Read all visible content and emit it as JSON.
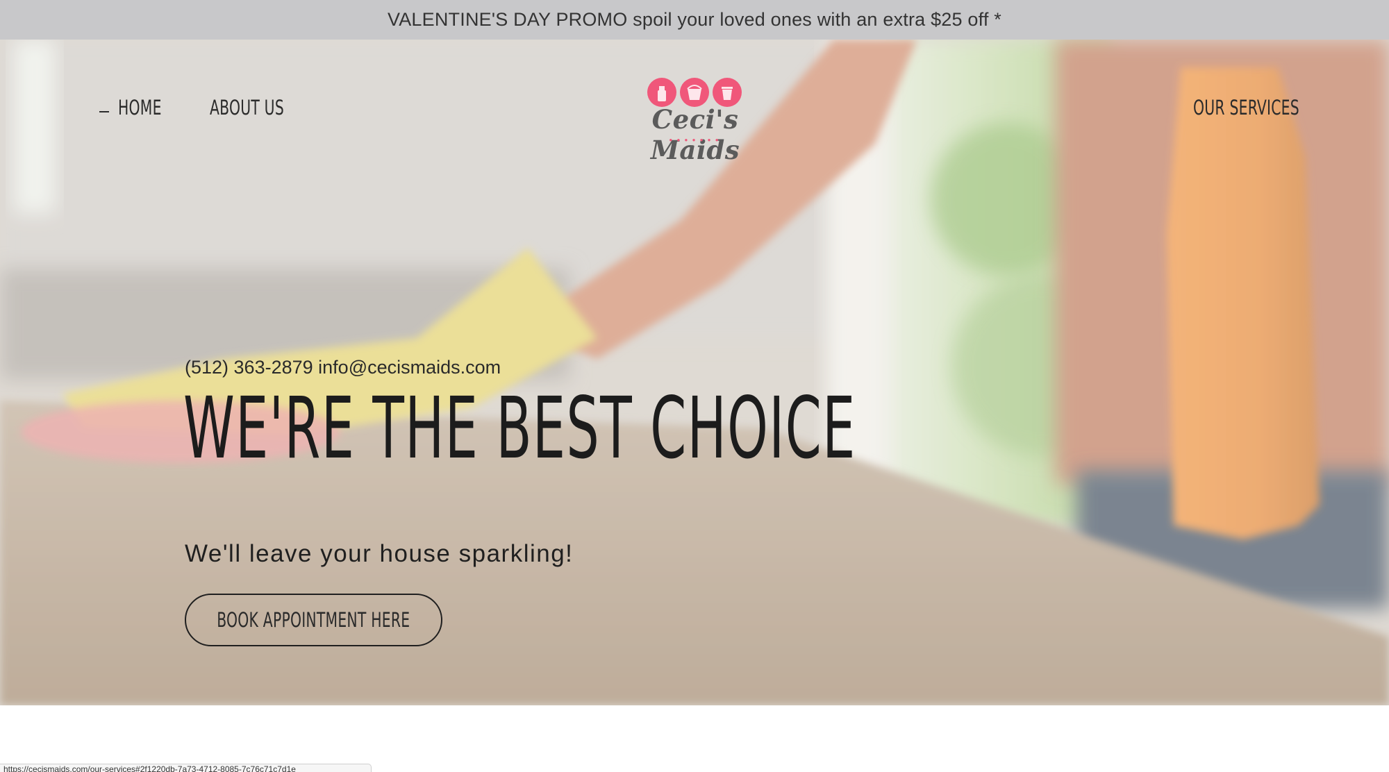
{
  "promo": {
    "text": "VALENTINE'S DAY PROMO spoil your loved ones with an extra $25 off *"
  },
  "nav": {
    "home": "HOME",
    "about": "ABOUT US",
    "services": "OUR SERVICES"
  },
  "logo": {
    "name": "Ceci's Maids",
    "icons": [
      "spray-bottle-icon",
      "bucket-icon",
      "trash-bin-icon"
    ],
    "accent_color": "#f0577a"
  },
  "hero": {
    "phone": "(512) 363-2879",
    "email": "info@cecismaids.com",
    "headline": "WE'RE THE BEST CHOICE",
    "subheadline": "We'll leave your house sparkling!",
    "cta_label": "BOOK APPOINTMENT HERE"
  },
  "status_bar": {
    "url": "https://cecismaids.com/our-services#2f1220db-7a73-4712-8085-7c76c71c7d1e"
  },
  "colors": {
    "promo_background": "#c8c8ca",
    "text_dark": "#1c1c1c",
    "logo_pink": "#f0577a"
  }
}
